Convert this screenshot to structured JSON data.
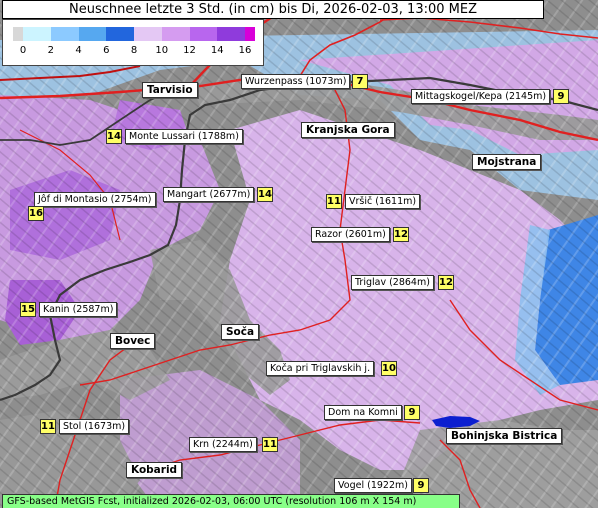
{
  "title": "Neuschnee letzte 3 Std. (in cm) bis Di, 2026-02-03, 13:00 MEZ",
  "legend": {
    "ticks": [
      "0",
      "2",
      "4",
      "6",
      "8",
      "10",
      "12",
      "14",
      "16"
    ],
    "colors": [
      "#d8d8d8",
      "#ccf4ff",
      "#8ccaff",
      "#56a8f0",
      "#2266dd",
      "#e4c8f4",
      "#d59cf0",
      "#b866ee",
      "#8f3bdc",
      "#d800d8"
    ]
  },
  "towns": [
    {
      "name": "Tarvisio"
    },
    {
      "name": "Kranjska Gora"
    },
    {
      "name": "Mojstrana"
    },
    {
      "name": "Bovec"
    },
    {
      "name": "Soča"
    },
    {
      "name": "Bohinjska Bistrica"
    },
    {
      "name": "Kobarid"
    }
  ],
  "peaks": [
    {
      "name": "Wurzenpass (1073m)",
      "value": "7"
    },
    {
      "name": "Mittagskogel/Kepa (2145m)",
      "value": "9"
    },
    {
      "name": "Monte Lussari (1788m)",
      "value": "14"
    },
    {
      "name": "Jôf di Montasio (2754m)",
      "value": "16"
    },
    {
      "name": "Mangart (2677m)",
      "value": "14"
    },
    {
      "name": "Vršič (1611m)",
      "value": "11"
    },
    {
      "name": "Razor (2601m)",
      "value": "12"
    },
    {
      "name": "Triglav (2864m)",
      "value": "12"
    },
    {
      "name": "Kanin (2587m)",
      "value": "15"
    },
    {
      "name": "Koča pri Triglavskih j.",
      "value": "10"
    },
    {
      "name": "Dom na Komni",
      "value": "9"
    },
    {
      "name": "Stol (1673m)",
      "value": "11"
    },
    {
      "name": "Krn (2244m)",
      "value": "11"
    },
    {
      "name": "Vogel (1922m)",
      "value": "9"
    }
  ],
  "footer": "GFS-based MetGIS Fcst, initialized 2026-02-03, 06:00 UTC  (resolution 106 m X 154 m)"
}
